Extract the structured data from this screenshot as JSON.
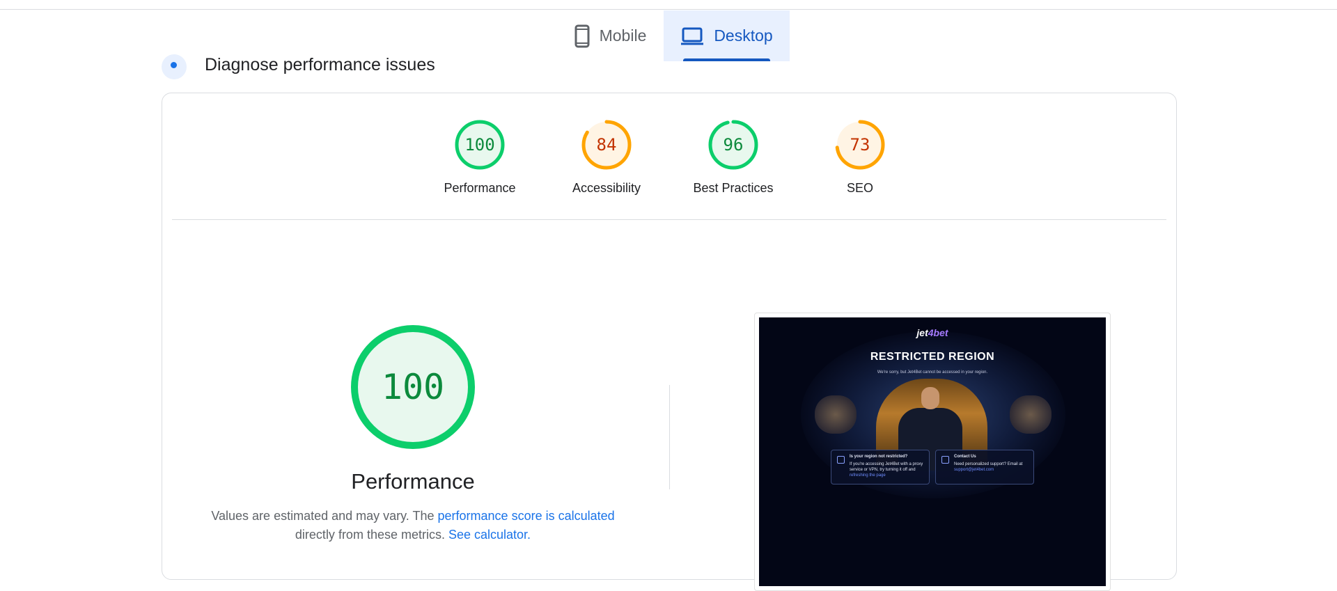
{
  "device_tabs": [
    {
      "label": "Mobile",
      "icon": "phone-icon",
      "selected": false
    },
    {
      "label": "Desktop",
      "icon": "laptop-icon",
      "selected": true
    }
  ],
  "section": {
    "title": "Diagnose performance issues"
  },
  "categories": [
    {
      "label": "Performance",
      "score": "100",
      "value": 1.0,
      "color": "#0cce6b",
      "bg": "#e8f8ee",
      "text_color": "#0c8a3c"
    },
    {
      "label": "Accessibility",
      "score": "84",
      "value": 0.84,
      "color": "#ffa400",
      "bg": "#fff4e4",
      "text_color": "#c33300"
    },
    {
      "label": "Best Practices",
      "score": "96",
      "value": 0.96,
      "color": "#0cce6b",
      "bg": "#e8f8ee",
      "text_color": "#0c8a3c"
    },
    {
      "label": "SEO",
      "score": "73",
      "value": 0.73,
      "color": "#ffa400",
      "bg": "#fff4e4",
      "text_color": "#c33300"
    }
  ],
  "performance": {
    "score": "100",
    "title": "Performance",
    "desc_prefix": "Values are estimated and may vary. The ",
    "link_score": "performance score is calculated",
    "desc_mid": " directly from these metrics. ",
    "link_calc": "See calculator."
  },
  "screenshot": {
    "logo_pre": "jet",
    "logo_accent": "4bet",
    "headline": "RESTRICTED REGION",
    "subtext": "We're sorry, but Jet4Bet cannot be accessed in your region.",
    "box_left": {
      "title": "Is your region not restricted?",
      "text": "If you're accessing Jet4Bet with a proxy service or VPN, try turning it off and ",
      "link": "refreshing the page"
    },
    "box_right": {
      "title": "Contact Us",
      "text": "Need personalized support? Email at ",
      "link": "support@jet4bet.com"
    }
  }
}
